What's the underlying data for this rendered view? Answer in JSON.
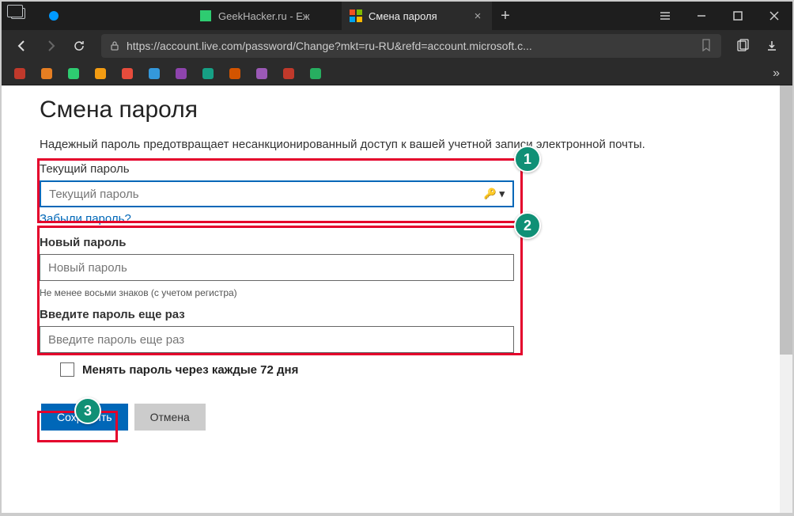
{
  "window": {
    "tabs": [
      {
        "label": ""
      },
      {
        "label": "GeekHacker.ru - Еж"
      },
      {
        "label": "Смена пароля"
      }
    ]
  },
  "toolbar": {
    "url": "https://account.live.com/password/Change?mkt=ru-RU&refd=account.microsoft.c..."
  },
  "page": {
    "heading": "Смена пароля",
    "description": "Надежный пароль предотвращает несанкционированный доступ к вашей учетной записи электронной почты.",
    "current_label": "Текущий пароль",
    "current_placeholder": "Текущий пароль",
    "forgot": "Забыли пароль?",
    "new_label": "Новый пароль",
    "new_placeholder": "Новый пароль",
    "hint": "Не менее восьми знаков (с учетом регистра)",
    "confirm_label": "Введите пароль еще раз",
    "confirm_placeholder": "Введите пароль еще раз",
    "rotate_label": "Менять пароль через каждые 72 дня",
    "save": "Сохранить",
    "cancel": "Отмена"
  },
  "annotations": {
    "b1": "1",
    "b2": "2",
    "b3": "3"
  }
}
